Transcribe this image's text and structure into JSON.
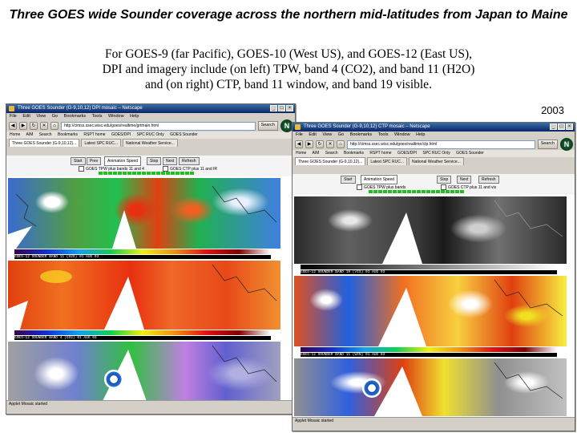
{
  "slide": {
    "title": "Three GOES wide Sounder coverage across the northern mid-latitudes from Japan to Maine",
    "subtitle_line1": "For GOES-9 (far Pacific), GOES-10 (West US), and GOES-12 (East US),",
    "subtitle_line2": "DPI and imagery include (on left) TPW, band 4 (CO2), and band 11 (H2O)",
    "subtitle_line3": "and (on right) CTP, band 11 window, and band 19 visible.",
    "year": "2003"
  },
  "left_window": {
    "title": "Three GOES Sounder (G-9,10,12) DPI mosaic – Netscape",
    "menu": [
      "File",
      "Edit",
      "View",
      "Go",
      "Bookmarks",
      "Tools",
      "Window",
      "Help"
    ],
    "url": "http://cimss.ssec.wisc.edu/goes/realtime/grtmain.html",
    "search_label": "Search",
    "bookmarks": [
      "Home",
      "AIM",
      "Search",
      "Bookmarks",
      "RSPT home",
      "GOES/DPI",
      "SPC RUC Only",
      "GOES Sounder",
      "CIMSS",
      "NEXRAD"
    ],
    "tabs": [
      "Three GOES Sounder (G-9,10,12)...",
      "Latest SPC RUC...",
      "National Weather Service..."
    ],
    "buttons": [
      "Start",
      "Prev",
      "Stop",
      "Next",
      "Refresh"
    ],
    "speed_label": "Animation Speed",
    "checkbox1": "GOES TPW plus bands 11 and 4",
    "checkbox2": "GOES CTP plus 11 and IR",
    "status": "Applet Mosaic started",
    "captions": [
      "GOES-12 SOUNDER BAND 11 (H2O)  01 AUG 03",
      "GOES-12 SOUNDER BAND 4 (CO2)  01 AUG 03",
      "GOES-12 SOUNDER TPW  01 AUG 03"
    ]
  },
  "right_window": {
    "title": "Three GOES Sounder (G-9,10,12) CTP mosaic – Netscape",
    "menu": [
      "File",
      "Edit",
      "View",
      "Go",
      "Bookmarks",
      "Tools",
      "Window",
      "Help"
    ],
    "url": "http://cimss.ssec.wisc.edu/goes/realtime/ctp.html",
    "search_label": "Search",
    "bookmarks": [
      "Home",
      "AIM",
      "Search",
      "Bookmarks",
      "RSPT home",
      "GOES/DPI",
      "SPC RUC Only",
      "GOES Sounder",
      "CIMSS",
      "NEXRAD"
    ],
    "tabs": [
      "Three GOES Sounder (G-9,10,12)...",
      "Latest SPC RUC...",
      "National Weather Service..."
    ],
    "buttons": [
      "Start",
      "Stop",
      "Next",
      "Refresh"
    ],
    "speed_label": "Animation Speed",
    "checkbox1": "GOES TPW plus bands",
    "checkbox2": "GOES CTP plus 11 and vis",
    "status": "Applet Mosaic started",
    "captions": [
      "GOES-12 SOUNDER BAND 19 (VIS)  01 AUG 03",
      "GOES-12 SOUNDER BAND 11 (WIN)  01 AUG 03",
      "GOES-12 SOUNDER CLOUD TOP PRESSURE  01 AUG 03"
    ]
  },
  "colors": {
    "titlebar": "#0a246a",
    "frame_indicator": "#20c020"
  }
}
